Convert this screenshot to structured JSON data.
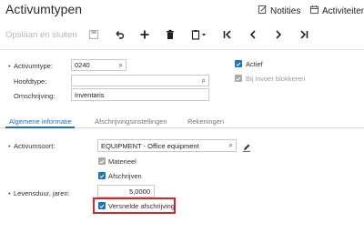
{
  "header": {
    "title": "Activumtypen",
    "notes_label": "Notities",
    "activities_label": "Activiteiten"
  },
  "toolbar": {
    "save_close_label": "Opslaan en sluiten",
    "icons": [
      "save-icon",
      "undo-icon",
      "add-icon",
      "delete-icon",
      "copy-paste-icon",
      "first-icon",
      "previous-icon",
      "next-icon",
      "last-icon"
    ]
  },
  "form": {
    "asset_type_label": "Activumtype:",
    "asset_type_value": "0240",
    "main_type_label": "Hoofdtype:",
    "main_type_value": "",
    "description_label": "Omschrijving:",
    "description_value": "Inventaris",
    "active_label": "Actief",
    "active_checked": true,
    "block_on_entry_label": "Bij invoer blokkeren",
    "block_on_entry_checked": false
  },
  "tabs": [
    {
      "label": "Algemene informatie",
      "active": true
    },
    {
      "label": "Afschrijvingsinstellingen",
      "active": false
    },
    {
      "label": "Rekeningen",
      "active": false
    }
  ],
  "general": {
    "asset_class_label": "Activumsoort:",
    "asset_class_value": "EQUIPMENT - Office equipment",
    "tangible_label": "Materieel",
    "tangible_checked": true,
    "depreciate_label": "Afschrijven",
    "depreciate_checked": true,
    "useful_life_label": "Levensduur, jaren:",
    "useful_life_value": "5,0000",
    "accelerated_label": "Versnelde afschrijving",
    "accelerated_checked": true
  },
  "colors": {
    "accent": "#1a6fc0",
    "highlight": "#d6262b"
  }
}
